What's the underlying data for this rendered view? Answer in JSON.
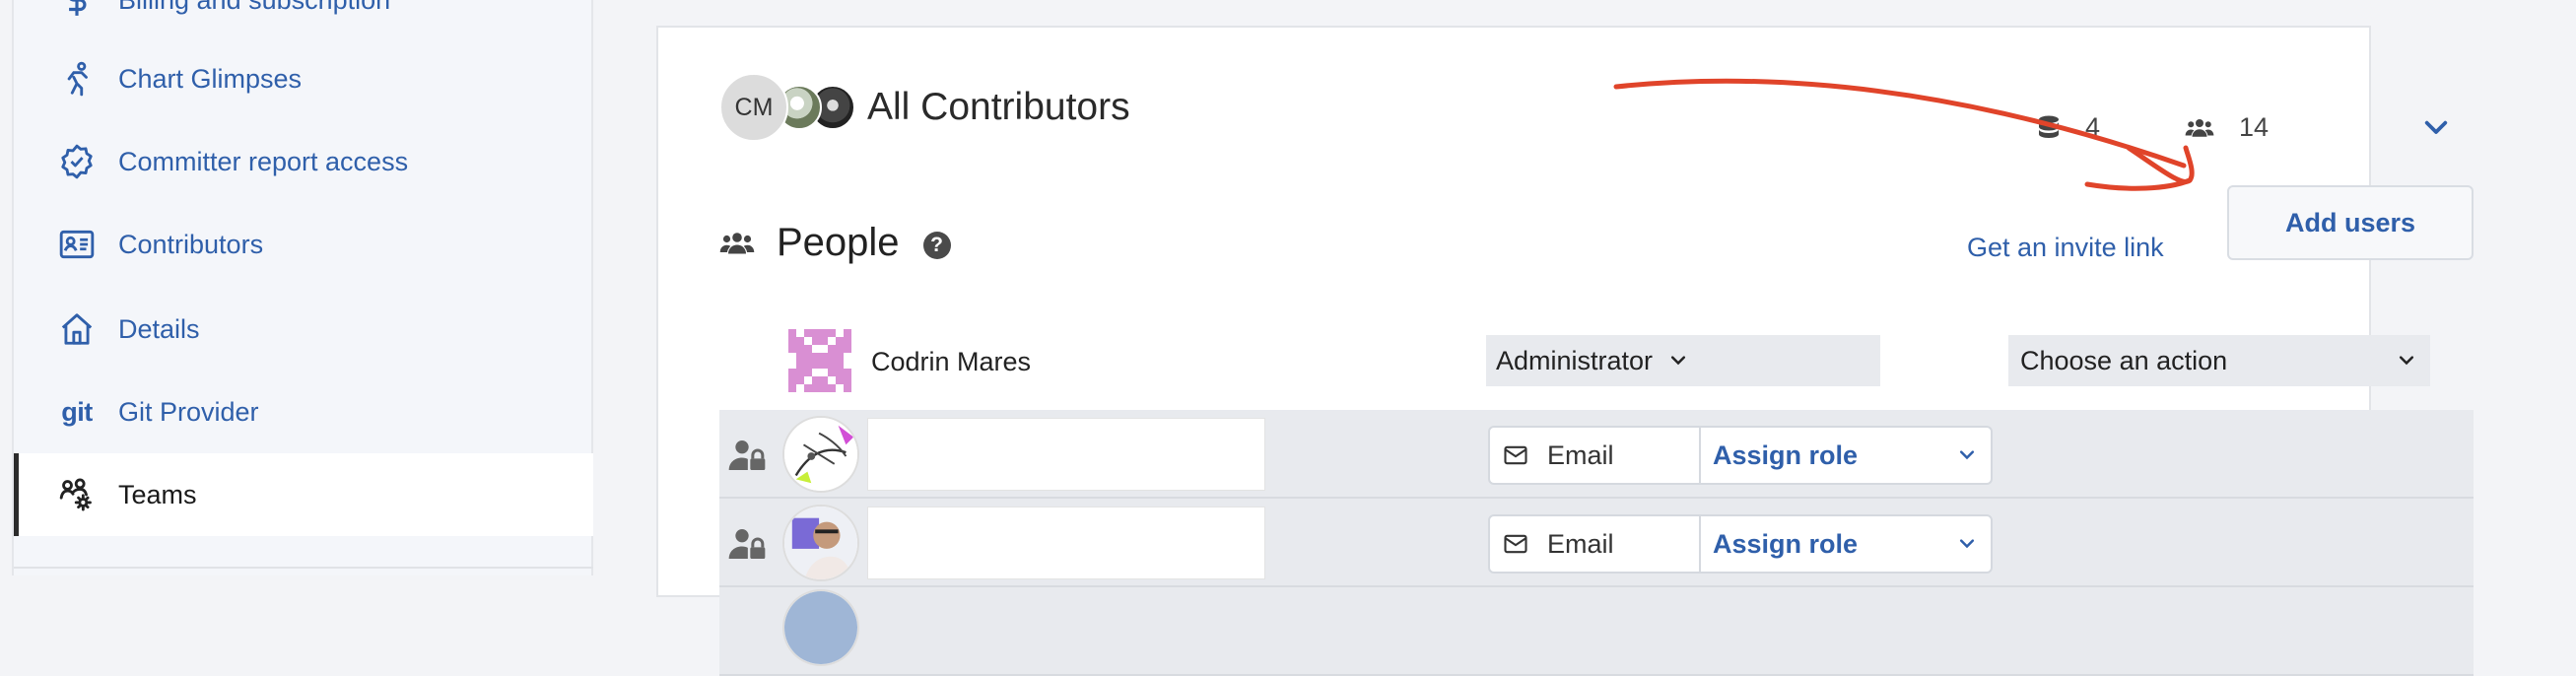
{
  "sidebar": {
    "items": [
      {
        "label": "Billing and subscription",
        "icon": "dollar-icon"
      },
      {
        "label": "Chart Glimpses",
        "icon": "running-person-icon"
      },
      {
        "label": "Committer report access",
        "icon": "badge-check-icon"
      },
      {
        "label": "Contributors",
        "icon": "id-card-icon"
      },
      {
        "label": "Details",
        "icon": "home-icon"
      },
      {
        "label": "Git Provider",
        "icon": "git-icon",
        "icon_text": "git"
      },
      {
        "label": "Teams",
        "icon": "users-gear-icon",
        "active": true
      }
    ]
  },
  "team": {
    "avatar_initials": "CM",
    "name": "All Contributors",
    "repo_count": "4",
    "member_count": "14"
  },
  "people": {
    "title": "People",
    "help_glyph": "?",
    "invite_link": "Get an invite link",
    "add_users": "Add users",
    "admin": {
      "name": "Codrin Mares",
      "role": "Administrator",
      "action_placeholder": "Choose an action"
    },
    "pending": [
      {
        "email_label": "Email",
        "assign_label": "Assign role"
      },
      {
        "email_label": "Email",
        "assign_label": "Assign role"
      }
    ]
  },
  "colors": {
    "link": "#2f5faa",
    "annotation_arrow": "#e0442a",
    "row_bg": "#e8eaee"
  }
}
